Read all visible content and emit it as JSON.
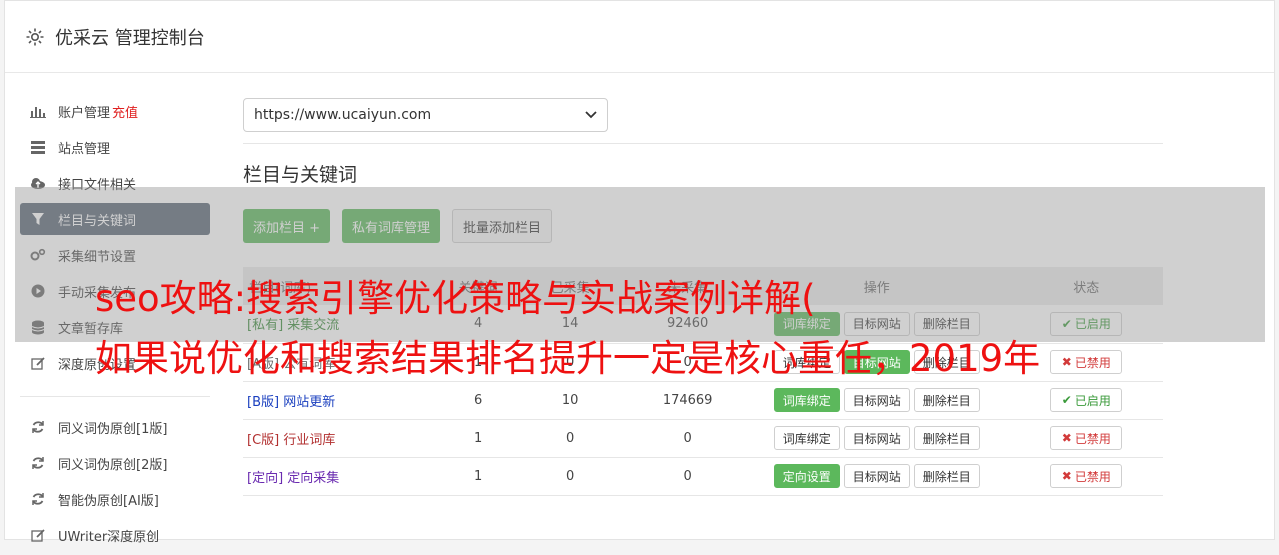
{
  "header": {
    "title": "优采云 管理控制台"
  },
  "sidebar": {
    "items": [
      {
        "label": "账户管理",
        "extra": "充值",
        "icon": "bar-chart-icon"
      },
      {
        "label": "站点管理",
        "icon": "server-icon"
      },
      {
        "label": "接口文件相关",
        "icon": "cloud-upload-icon"
      },
      {
        "label": "栏目与关键词",
        "icon": "filter-icon",
        "active": true
      },
      {
        "label": "采集细节设置",
        "icon": "gears-icon"
      },
      {
        "label": "手动采集发布",
        "icon": "play-icon"
      },
      {
        "label": "文章暂存库",
        "icon": "database-icon"
      },
      {
        "label": "深度原创设置",
        "icon": "edit-icon"
      }
    ],
    "items2": [
      {
        "label": "同义词伪原创[1版]",
        "icon": "refresh-icon"
      },
      {
        "label": "同义词伪原创[2版]",
        "icon": "refresh-icon"
      },
      {
        "label": "智能伪原创[AI版]",
        "icon": "refresh-icon"
      },
      {
        "label": "UWriter深度原创",
        "icon": "edit-icon"
      }
    ]
  },
  "main": {
    "site_select": "https://www.ucaiyun.com",
    "section_title": "栏目与关键词",
    "buttons": {
      "add_column": "添加栏目 +",
      "private_lib": "私有词库管理",
      "batch_add": "批量添加栏目"
    },
    "table": {
      "headers": [
        "栏目(词库)",
        "关键词",
        "已采集",
        "未采集",
        "操作",
        "状态"
      ],
      "rows": [
        {
          "tag": "[私有]",
          "name": "采集交流",
          "c1": "4",
          "c2": "14",
          "c3": "92460",
          "bind": "词库绑定",
          "target": "目标网站",
          "del": "删除栏目",
          "status": "已启用",
          "on": true
        },
        {
          "tag": "[A版]",
          "name": "公有词库",
          "c1": "1",
          "c2": "0",
          "c3": "0",
          "bind": "词库绑定",
          "target": "目标网站",
          "del": "删除栏目",
          "status": "已禁用",
          "on": false
        },
        {
          "tag": "[B版]",
          "name": "网站更新",
          "c1": "6",
          "c2": "10",
          "c3": "174669",
          "bind": "词库绑定",
          "target": "目标网站",
          "del": "删除栏目",
          "status": "已启用",
          "on": true
        },
        {
          "tag": "[C版]",
          "name": "行业词库",
          "c1": "1",
          "c2": "0",
          "c3": "0",
          "bind": "词库绑定",
          "target": "目标网站",
          "del": "删除栏目",
          "status": "已禁用",
          "on": false
        },
        {
          "tag": "[定向]",
          "name": "定向采集",
          "c1": "1",
          "c2": "0",
          "c3": "0",
          "bind": "定向设置",
          "target": "目标网站",
          "del": "删除栏目",
          "status": "已禁用",
          "on": false
        }
      ]
    }
  },
  "overlay": {
    "line1": "seo攻略:搜索引擎优化策略与实战案例详解(",
    "line2": "如果说优化和搜索结果排名提升一定是核心重任，2019年"
  }
}
